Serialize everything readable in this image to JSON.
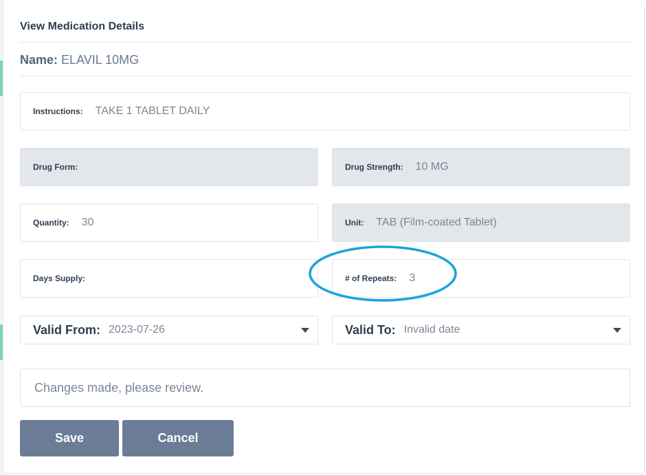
{
  "dialog": {
    "title": "View Medication Details",
    "name_label": "Name:",
    "name_value": "ELAVIL 10MG"
  },
  "fields": {
    "instructions": {
      "label": "Instructions:",
      "value": "TAKE 1 TABLET DAILY"
    },
    "drug_form": {
      "label": "Drug Form:",
      "value": ""
    },
    "drug_strength": {
      "label": "Drug Strength:",
      "value": "10 MG"
    },
    "quantity": {
      "label": "Quantity:",
      "value": "30"
    },
    "unit": {
      "label": "Unit:",
      "value": "TAB (Film-coated Tablet)"
    },
    "days_supply": {
      "label": "Days Supply:",
      "value": ""
    },
    "repeats": {
      "label": "# of Repeats:",
      "value": "3"
    }
  },
  "dates": {
    "valid_from": {
      "label": "Valid From:",
      "value": "2023-07-26"
    },
    "valid_to": {
      "label": "Valid To:",
      "value": "Invalid date"
    }
  },
  "notice": "Changes made, please review.",
  "buttons": {
    "save": "Save",
    "cancel": "Cancel"
  },
  "colors": {
    "button": "#6b7d96",
    "annotation": "#1aa3dc",
    "disabled_field": "#e3e7eb"
  }
}
